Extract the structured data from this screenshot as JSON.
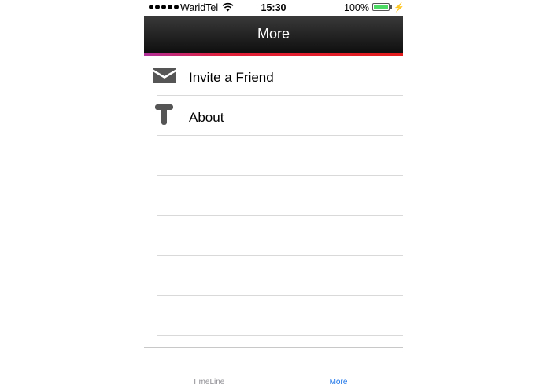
{
  "status_bar": {
    "carrier": "WaridTel",
    "time": "15:30",
    "battery_percent": "100%",
    "battery_level": 1.0
  },
  "nav": {
    "title": "More"
  },
  "menu": {
    "items": [
      {
        "label": "Invite a Friend",
        "icon": "mail-icon"
      },
      {
        "label": "About",
        "icon": "about-icon"
      }
    ],
    "empty_rows": 5
  },
  "tab_bar": {
    "tabs": [
      {
        "label": "TimeLine",
        "selected": false
      },
      {
        "label": "More",
        "selected": true
      }
    ]
  },
  "colors": {
    "nav_background": "#1a1a1a",
    "accent_stripe": "#e31d1d",
    "accent_stripe_start": "#b0309a",
    "battery_green": "#4cd964",
    "selected_tab": "#1a73e8",
    "unselected_tab": "#8e8e93",
    "icon_gray": "#555555"
  }
}
